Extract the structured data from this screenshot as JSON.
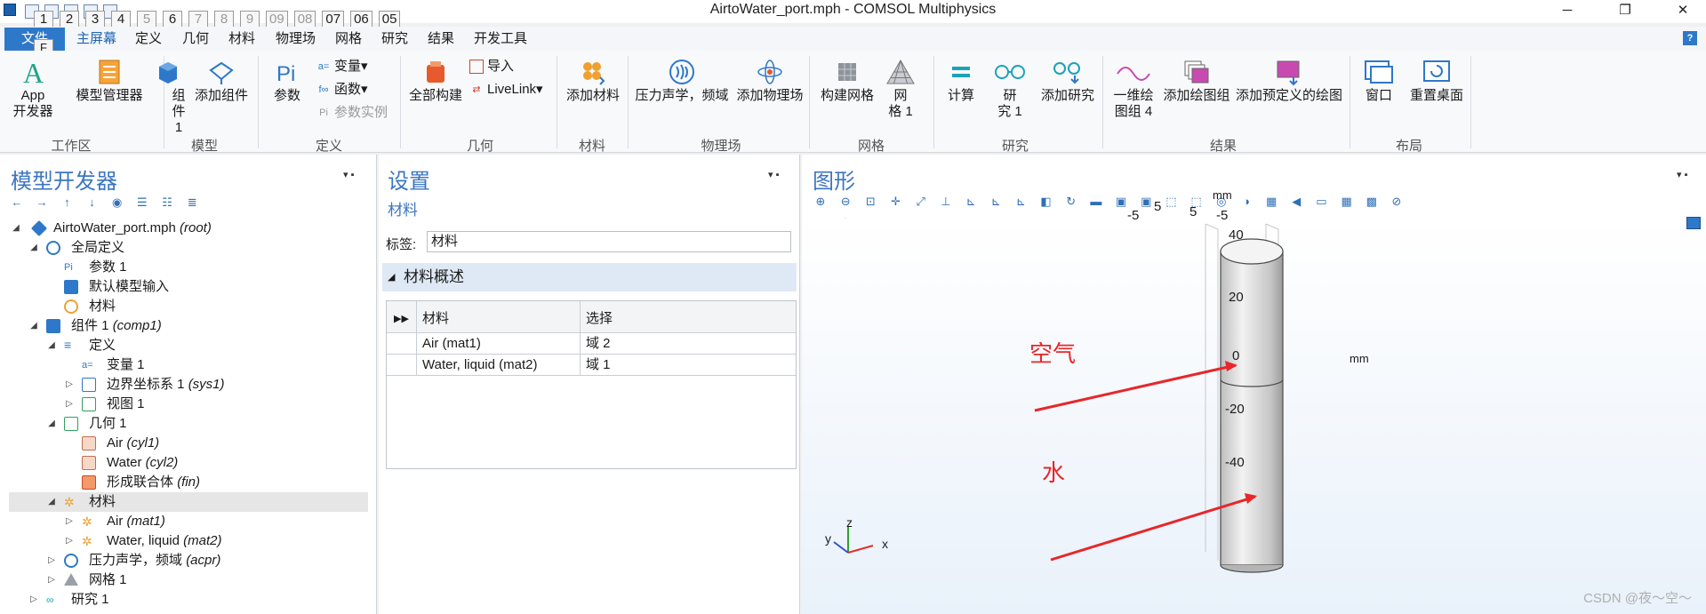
{
  "window": {
    "title": "AirtoWater_port.mph - COMSOL Multiphysics",
    "minimize": "─",
    "restore": "❐",
    "close": "✕"
  },
  "keytips": [
    "1",
    "2",
    "3",
    "4",
    "5",
    "6",
    "7",
    "8",
    "9",
    "09",
    "08",
    "07",
    "06",
    "05"
  ],
  "tabs": {
    "file": "文件",
    "file_keytip": "F",
    "items": [
      "主屏幕",
      "定义",
      "几何",
      "材料",
      "物理场",
      "网格",
      "研究",
      "结果",
      "开发工具"
    ],
    "help": "?"
  },
  "ribbon": {
    "workspace": {
      "app_builder": "App\n开发器",
      "model_manager": "模型管理器",
      "label": "工作区"
    },
    "model": {
      "component": "组\n件 1",
      "add_component": "添加组件",
      "label": "模型"
    },
    "definitions": {
      "parameters": "参数",
      "variables": "变量",
      "functions": "函数",
      "param_case": "参数实例",
      "label": "定义"
    },
    "geometry": {
      "build_all": "全部构建",
      "import": "导入",
      "livelink": "LiveLink",
      "label": "几何"
    },
    "materials": {
      "add_material": "添加材料",
      "label": "材料"
    },
    "physics": {
      "pressure_acoustics": "压力声学，频域",
      "add_physics": "添加物理场",
      "label": "物理场"
    },
    "mesh": {
      "build_mesh": "构建网格",
      "mesh1": "网\n格 1",
      "label": "网格"
    },
    "study": {
      "compute": "计算",
      "study1": "研\n究 1",
      "add_study": "添加研究",
      "label": "研究"
    },
    "results": {
      "plot1d": "一维绘\n图组 4",
      "add_plot_group": "添加绘图组",
      "add_predefined": "添加预定义的绘图",
      "label": "结果"
    },
    "layout": {
      "windows": "窗口",
      "reset_desktop": "重置桌面",
      "label": "布局"
    }
  },
  "model_builder": {
    "title": "模型开发器",
    "tree": [
      {
        "label": "AirtoWater_port.mph",
        "tag": "(root)"
      },
      {
        "label": "全局定义",
        "tag": ""
      },
      {
        "label": "参数 1",
        "tag": ""
      },
      {
        "label": "默认模型输入",
        "tag": ""
      },
      {
        "label": "材料",
        "tag": ""
      },
      {
        "label": "组件 1",
        "tag": "(comp1)"
      },
      {
        "label": "定义",
        "tag": ""
      },
      {
        "label": "变量 1",
        "tag": ""
      },
      {
        "label": "边界坐标系 1",
        "tag": "(sys1)"
      },
      {
        "label": "视图 1",
        "tag": ""
      },
      {
        "label": "几何 1",
        "tag": ""
      },
      {
        "label": "Air",
        "tag": "(cyl1)"
      },
      {
        "label": "Water",
        "tag": "(cyl2)"
      },
      {
        "label": "形成联合体",
        "tag": "(fin)"
      },
      {
        "label": "材料",
        "tag": ""
      },
      {
        "label": "Air",
        "tag": "(mat1)"
      },
      {
        "label": "Water, liquid",
        "tag": "(mat2)"
      },
      {
        "label": "压力声学，频域",
        "tag": "(acpr)"
      },
      {
        "label": "网格 1",
        "tag": ""
      },
      {
        "label": "研究 1",
        "tag": ""
      }
    ]
  },
  "settings": {
    "title": "设置",
    "subtitle": "材料",
    "label_caption": "标签:",
    "label_value": "材料",
    "section": "材料概述",
    "table": {
      "headers": [
        "材料",
        "选择"
      ],
      "rows": [
        {
          "material": "Air (mat1)",
          "selection": "域 2"
        },
        {
          "material": "Water, liquid (mat2)",
          "selection": "域 1"
        }
      ]
    }
  },
  "graphics": {
    "title": "图形",
    "axis_top_labels": [
      "-5",
      "5",
      "5",
      "-5"
    ],
    "unit_top": "mm",
    "z_ticks": [
      "40",
      "20",
      "0",
      "-20",
      "-40"
    ],
    "unit_side": "mm",
    "annotations": {
      "air": "空气",
      "water": "水"
    },
    "triad": {
      "x": "x",
      "y": "y",
      "z": "z"
    },
    "watermark": "CSDN @夜～空～"
  },
  "colors": {
    "accent": "#2e78c9",
    "pane_title": "#3c76c0",
    "annotation": "#e8262a"
  }
}
